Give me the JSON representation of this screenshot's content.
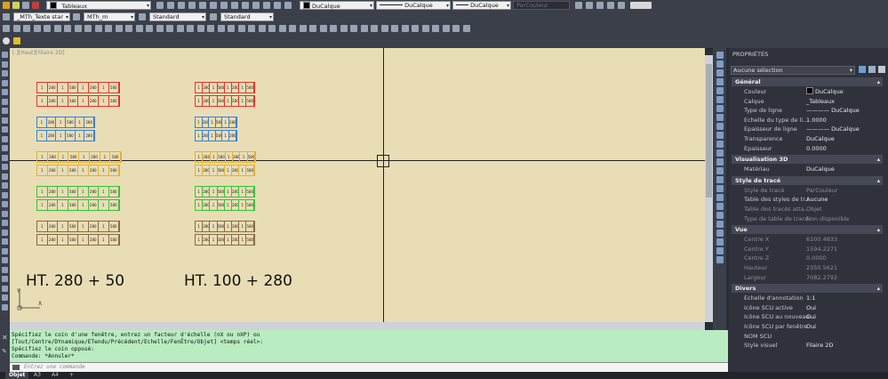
{
  "toolbar_row1": {
    "layer_combo": "_Tableaux",
    "color_combo": "DuCalque",
    "linetype_combo": "DuCalque",
    "lineweight_combo": "DuCalque",
    "plotstyle_combo": "ParCouleur"
  },
  "toolbar_row2": {
    "text_style_combo": "_MTh_Texte star",
    "dim_style_combo": "MTh_m",
    "table_style_combo": "Standard",
    "mleader_style_combo": "Standard"
  },
  "viewport_label": "[-][Haut][Filaire 2D]",
  "canvas": {
    "label_left": "HT. 280 + 50",
    "label_right": "HT. 100 + 280",
    "ucs_y": "Y",
    "ucs_x": "X",
    "cell_text": [
      "1",
      "280",
      "1",
      "580",
      "1",
      "280",
      "1",
      "580",
      "1",
      "280"
    ],
    "block_colors": [
      "#e8332a",
      "#3a7fd0",
      "#e6b030",
      "#36c236",
      "#8a6a40"
    ]
  },
  "properties": {
    "title": "PROPRIÉTÉS",
    "selection": "Aucune sélection",
    "sections": {
      "general": "Général",
      "vis3d": "Visualisation 3D",
      "plot": "Style de tracé",
      "view": "Vue",
      "misc": "Divers"
    },
    "general": [
      {
        "k": "Couleur",
        "v": "DuCalque"
      },
      {
        "k": "Calque",
        "v": "_Tableaux"
      },
      {
        "k": "Type de ligne",
        "v": "———— DuCalque"
      },
      {
        "k": "Echelle du type de li...",
        "v": "1.0000"
      },
      {
        "k": "Epaisseur de ligne",
        "v": "———— DuCalque"
      },
      {
        "k": "Transparence",
        "v": "DuCalque"
      },
      {
        "k": "Epaisseur",
        "v": "0.0000"
      }
    ],
    "vis3d": [
      {
        "k": "Matériau",
        "v": "DuCalque"
      }
    ],
    "plot": [
      {
        "k": "Style de tracé",
        "v": "ParCouleur"
      },
      {
        "k": "Table des styles de tr...",
        "v": "Aucune"
      },
      {
        "k": "Table des tracés atta...",
        "v": "Objet"
      },
      {
        "k": "Type de table de tracé",
        "v": "Non disponible"
      }
    ],
    "view": [
      {
        "k": "Centre X",
        "v": "6100.4833"
      },
      {
        "k": "Centre Y",
        "v": "1594.2271"
      },
      {
        "k": "Centre Z",
        "v": "0.0000"
      },
      {
        "k": "Hauteur",
        "v": "2350.5621"
      },
      {
        "k": "Largeur",
        "v": "7082.2792"
      }
    ],
    "misc": [
      {
        "k": "Echelle d'annotation",
        "v": "1:1"
      },
      {
        "k": "Icône SCU active",
        "v": "Oui"
      },
      {
        "k": "Icône SCU au nouveau...",
        "v": "Oui"
      },
      {
        "k": "Icône SCU par fenêtre",
        "v": "Oui"
      },
      {
        "k": "NOM SCU",
        "v": ""
      },
      {
        "k": "Style visuel",
        "v": "Filaire 2D"
      }
    ]
  },
  "command": {
    "line1": "Spécifiez le coin d'une fenêtre, entrez un facteur d'échelle (nX ou nXP) ou",
    "line2": "[Tout/Centre/DYnamique/ETendu/Précédent/Echelle/FenÊtre/Objet] <temps réel>:",
    "line3": "Spécifiez le coin opposé:",
    "line4": "Commande: *Annuler*",
    "placeholder": "Entrez une commande"
  },
  "layout_tabs": [
    "Objet",
    "A3",
    "A4",
    "+"
  ]
}
